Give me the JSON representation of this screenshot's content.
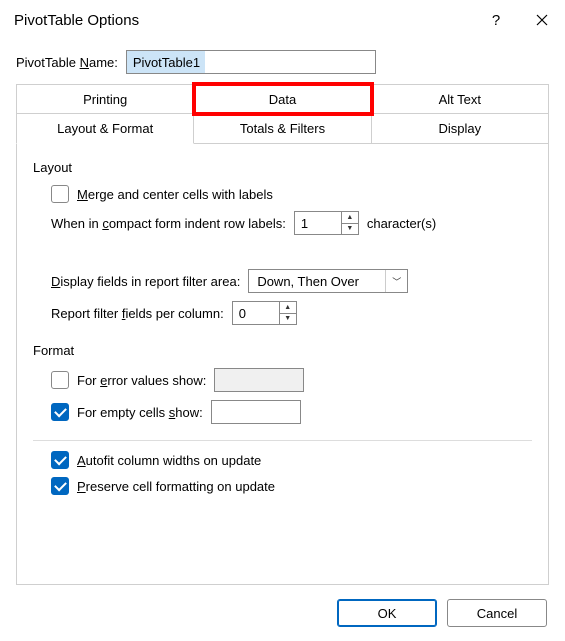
{
  "titlebar": {
    "title": "PivotTable Options",
    "help": "?",
    "close": "✕"
  },
  "name_row": {
    "label_pre": "PivotTable ",
    "label_key": "N",
    "label_post": "ame:",
    "value": "PivotTable1"
  },
  "tabs": {
    "row1": [
      {
        "label": "Printing"
      },
      {
        "label": "Data"
      },
      {
        "label": "Alt Text"
      }
    ],
    "row2": [
      {
        "label": "Layout & Format"
      },
      {
        "label": "Totals & Filters"
      },
      {
        "label": "Display"
      }
    ],
    "active": "Layout & Format",
    "highlighted": "Data"
  },
  "panel": {
    "layout_label": "Layout",
    "merge_checked": false,
    "merge_pre": "",
    "merge_key": "M",
    "merge_post": "erge and center cells with labels",
    "indent_pre": "When in ",
    "indent_key": "c",
    "indent_post": "ompact form indent row labels:",
    "indent_value": "1",
    "indent_suffix": "character(s)",
    "display_fields_pre": "",
    "display_fields_key": "D",
    "display_fields_post": "isplay fields in report filter area:",
    "display_fields_value": "Down, Then Over",
    "report_pre": "Report filter ",
    "report_key": "f",
    "report_post": "ields per column:",
    "report_value": "0",
    "format_label": "Format",
    "error_checked": false,
    "error_pre": "For ",
    "error_key": "e",
    "error_post": "rror values show:",
    "error_value": "",
    "empty_checked": true,
    "empty_pre": "For empty cells ",
    "empty_key": "s",
    "empty_post": "how:",
    "empty_value": "",
    "autofit_checked": true,
    "autofit_pre": "",
    "autofit_key": "A",
    "autofit_post": "utofit column widths on update",
    "preserve_checked": true,
    "preserve_pre": "",
    "preserve_key": "P",
    "preserve_post": "reserve cell formatting on update"
  },
  "buttons": {
    "ok": "OK",
    "cancel": "Cancel"
  }
}
